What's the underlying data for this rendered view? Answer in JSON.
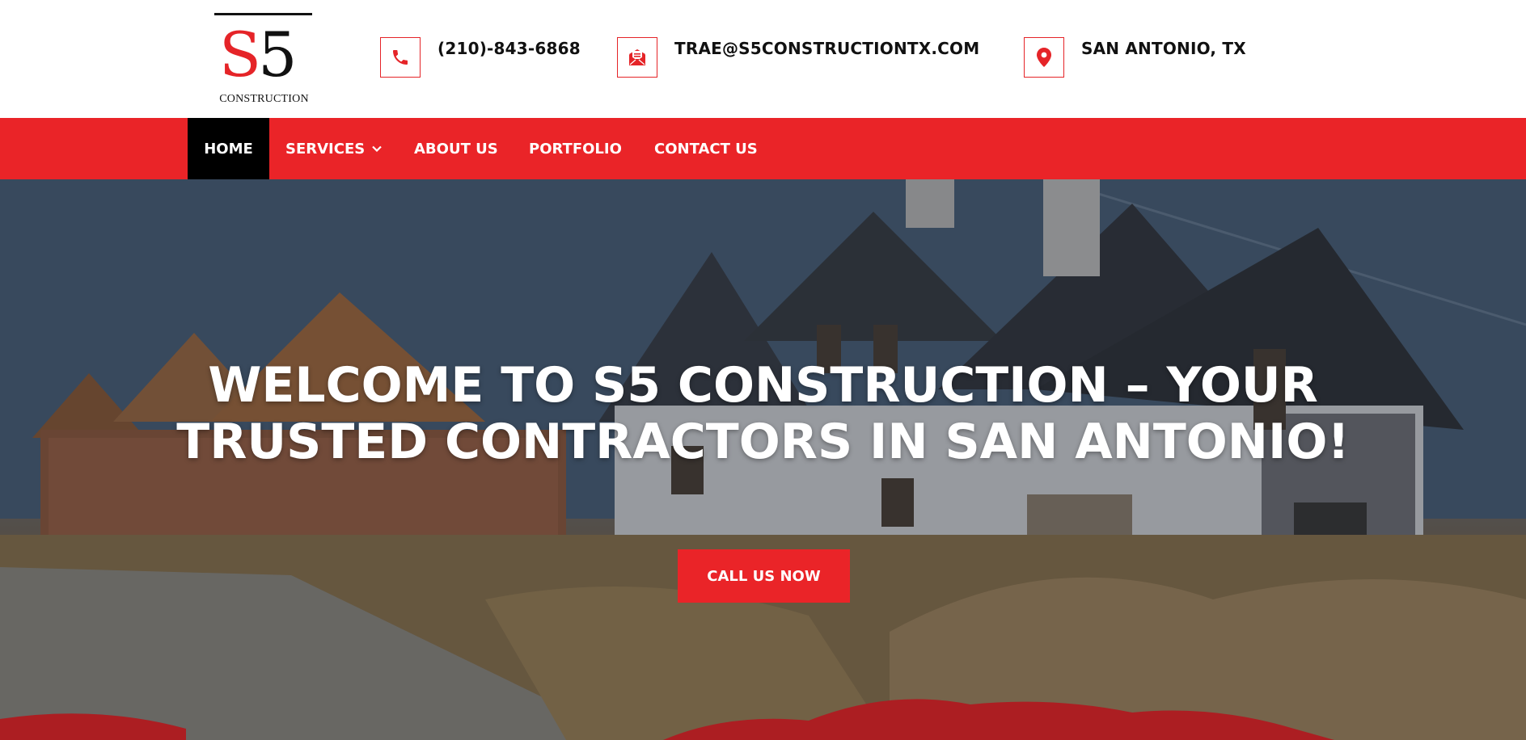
{
  "brand": {
    "logo_letter": "S",
    "logo_number": "5",
    "logo_word": "CONSTRUCTION",
    "accent_color": "#ea2428"
  },
  "header": {
    "phone": {
      "icon": "phone-icon",
      "text": "(210)-843-6868"
    },
    "email": {
      "icon": "envelope-icon",
      "text": "TRAE@S5CONSTRUCTIONTX.COM"
    },
    "location": {
      "icon": "map-pin-icon",
      "text": "SAN ANTONIO, TX"
    }
  },
  "nav": {
    "items": [
      {
        "label": "HOME",
        "active": true
      },
      {
        "label": "SERVICES",
        "has_dropdown": true
      },
      {
        "label": "ABOUT US"
      },
      {
        "label": "PORTFOLIO"
      },
      {
        "label": "CONTACT US"
      }
    ]
  },
  "hero": {
    "title": "WELCOME TO S5 CONSTRUCTION – YOUR TRUSTED CONTRACTORS IN SAN ANTONIO!",
    "cta_label": "CALL US NOW"
  }
}
